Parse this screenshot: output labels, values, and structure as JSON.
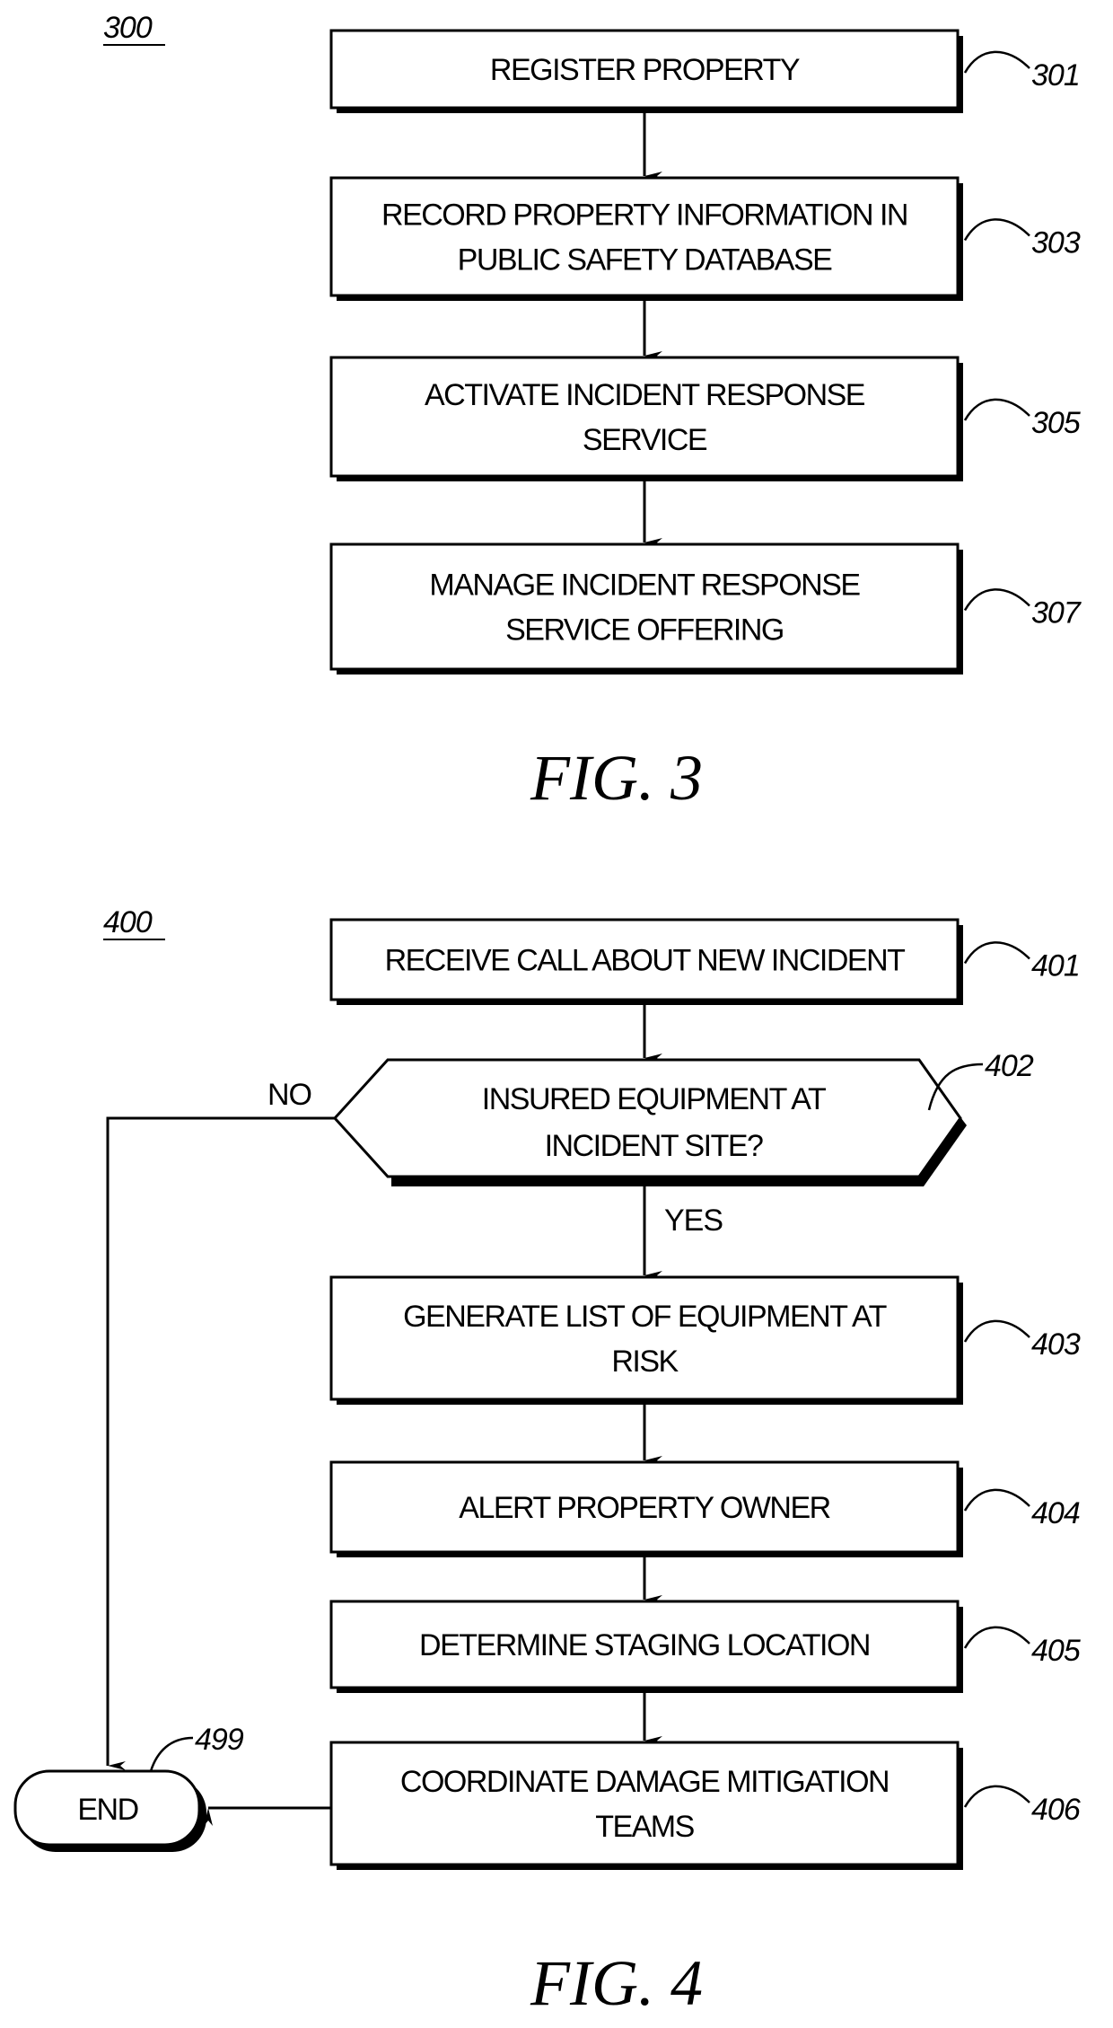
{
  "figure3": {
    "ref_label": "300",
    "caption": "FIG. 3",
    "steps": [
      {
        "ref": "301",
        "lines": [
          "REGISTER PROPERTY"
        ]
      },
      {
        "ref": "303",
        "lines": [
          "RECORD PROPERTY INFORMATION IN",
          "PUBLIC SAFETY DATABASE"
        ]
      },
      {
        "ref": "305",
        "lines": [
          "ACTIVATE INCIDENT RESPONSE",
          "SERVICE"
        ]
      },
      {
        "ref": "307",
        "lines": [
          "MANAGE INCIDENT RESPONSE",
          "SERVICE OFFERING"
        ]
      }
    ]
  },
  "figure4": {
    "ref_label": "400",
    "caption": "FIG. 4",
    "start": {
      "ref": "401",
      "lines": [
        "RECEIVE CALL ABOUT NEW INCIDENT"
      ]
    },
    "decision": {
      "ref": "402",
      "lines": [
        "INSURED EQUIPMENT AT",
        "INCIDENT SITE?"
      ],
      "yes_label": "YES",
      "no_label": "NO"
    },
    "steps": [
      {
        "ref": "403",
        "lines": [
          "GENERATE LIST OF EQUIPMENT AT",
          "RISK"
        ]
      },
      {
        "ref": "404",
        "lines": [
          "ALERT PROPERTY OWNER"
        ]
      },
      {
        "ref": "405",
        "lines": [
          "DETERMINE STAGING LOCATION"
        ]
      },
      {
        "ref": "406",
        "lines": [
          "COORDINATE DAMAGE MITIGATION",
          "TEAMS"
        ]
      }
    ],
    "end": {
      "ref": "499",
      "label": "END"
    }
  }
}
